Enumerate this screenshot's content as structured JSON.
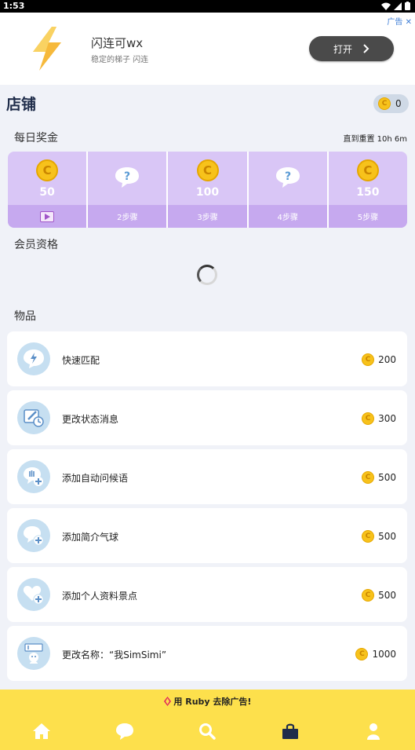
{
  "status_bar": {
    "time": "1:53"
  },
  "ad": {
    "title": "闪连可wx",
    "subtitle": "稳定的梯子 闪连",
    "tag": "广告",
    "button_label": "打开"
  },
  "shop": {
    "title": "店铺",
    "coin_balance": "0"
  },
  "daily_bonus": {
    "label": "每日奖金",
    "reset": "直到重置 10h 6m",
    "steps": [
      {
        "amount": "50",
        "reward": "coin",
        "footer": ""
      },
      {
        "amount": "",
        "reward": "mystery",
        "footer": "2步骤"
      },
      {
        "amount": "100",
        "reward": "coin",
        "footer": "3步骤"
      },
      {
        "amount": "",
        "reward": "mystery",
        "footer": "4步骤"
      },
      {
        "amount": "150",
        "reward": "coin",
        "footer": "5步骤"
      }
    ]
  },
  "membership": {
    "label": "会员资格"
  },
  "items_section": {
    "label": "物品",
    "items": [
      {
        "name": "快速匹配",
        "price": "200",
        "icon": "lightning-bubble-icon"
      },
      {
        "name": "更改状态消息",
        "price": "300",
        "icon": "edit-status-icon"
      },
      {
        "name": "添加自动问候语",
        "price": "500",
        "icon": "greeting-add-icon"
      },
      {
        "name": "添加简介气球",
        "price": "500",
        "icon": "bubble-add-icon"
      },
      {
        "name": "添加个人资料景点",
        "price": "500",
        "icon": "heart-add-icon"
      },
      {
        "name": "更改名称：“我SimSimi”",
        "price": "1000",
        "icon": "rename-icon"
      }
    ]
  },
  "promo": {
    "text": "用 Ruby 去除广告!"
  },
  "colors": {
    "accent_yellow": "#fde04c",
    "bonus_purple": "#d9c6f6",
    "coin_gold": "#f7c21b",
    "nav_active": "#1f2c4a"
  }
}
